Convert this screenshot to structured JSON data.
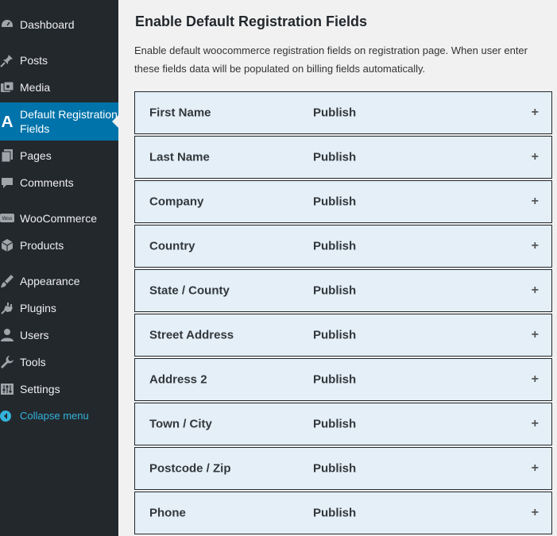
{
  "sidebar": {
    "items": [
      {
        "label": "Dashboard",
        "icon": "dashboard-icon"
      },
      {
        "label": "Posts",
        "icon": "pin-icon"
      },
      {
        "label": "Media",
        "icon": "media-icon"
      },
      {
        "label": "Default Registration Fields",
        "icon": "registration-fields-icon",
        "active": true
      },
      {
        "label": "Pages",
        "icon": "pages-icon"
      },
      {
        "label": "Comments",
        "icon": "comments-icon"
      },
      {
        "label": "WooCommerce",
        "icon": "woocommerce-icon"
      },
      {
        "label": "Products",
        "icon": "products-icon"
      },
      {
        "label": "Appearance",
        "icon": "appearance-icon"
      },
      {
        "label": "Plugins",
        "icon": "plugins-icon"
      },
      {
        "label": "Users",
        "icon": "users-icon"
      },
      {
        "label": "Tools",
        "icon": "tools-icon"
      },
      {
        "label": "Settings",
        "icon": "settings-icon"
      }
    ],
    "collapse_label": "Collapse menu"
  },
  "main": {
    "title": "Enable Default Registration Fields",
    "description": "Enable default woocommerce registration fields on registration page. When user enter these fields data will be populated on billing fields automatically.",
    "fields": [
      {
        "name": "First Name",
        "status": "Publish",
        "expand": "+"
      },
      {
        "name": "Last Name",
        "status": "Publish",
        "expand": "+"
      },
      {
        "name": "Company",
        "status": "Publish",
        "expand": "+"
      },
      {
        "name": "Country",
        "status": "Publish",
        "expand": "+"
      },
      {
        "name": "State / County",
        "status": "Publish",
        "expand": "+"
      },
      {
        "name": "Street Address",
        "status": "Publish",
        "expand": "+"
      },
      {
        "name": "Address 2",
        "status": "Publish",
        "expand": "+"
      },
      {
        "name": "Town / City",
        "status": "Publish",
        "expand": "+"
      },
      {
        "name": "Postcode / Zip",
        "status": "Publish",
        "expand": "+"
      },
      {
        "name": "Phone",
        "status": "Publish",
        "expand": "+"
      }
    ]
  },
  "colors": {
    "sidebar_bg": "#23282d",
    "active_bg": "#0073aa",
    "collapse_text": "#33b3db",
    "row_bg": "#e4eff7"
  }
}
